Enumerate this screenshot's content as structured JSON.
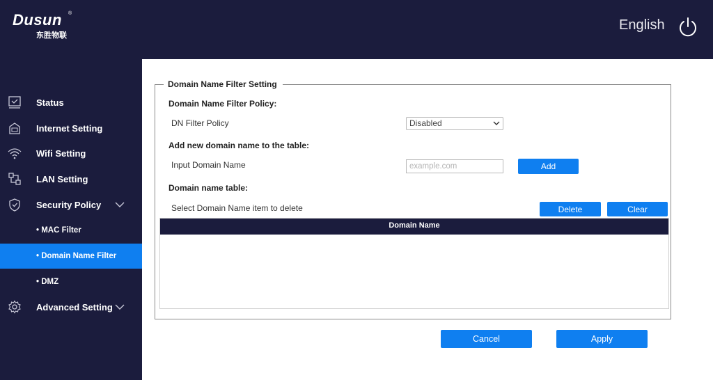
{
  "header": {
    "logo_text": "Dusun",
    "logo_reg": "®",
    "logo_subtext": "东胜物联",
    "language": "English",
    "power_icon": "power-icon"
  },
  "sidebar": {
    "items": [
      {
        "label": "Status",
        "icon": "status-icon"
      },
      {
        "label": "Internet Setting",
        "icon": "internet-icon"
      },
      {
        "label": "Wifi Setting",
        "icon": "wifi-icon"
      },
      {
        "label": "LAN Setting",
        "icon": "lan-icon"
      },
      {
        "label": "Security Policy",
        "icon": "shield-icon",
        "expanded": true
      },
      {
        "label": "Advanced Setting",
        "icon": "gear-icon"
      }
    ],
    "sub_items": [
      {
        "label": "• MAC Filter"
      },
      {
        "label": "• Domain Name Filter",
        "active": true
      },
      {
        "label": "• DMZ"
      }
    ]
  },
  "main": {
    "legend": "Domain Name Filter Setting",
    "policy_heading": "Domain Name Filter Policy:",
    "policy_label": "DN Filter Policy",
    "policy_value": "Disabled",
    "add_heading": "Add new domain name to the table:",
    "input_label": "Input Domain Name",
    "input_placeholder": "example.com",
    "add_button": "Add",
    "table_heading": "Domain name table:",
    "delete_hint": "Select Domain Name item to delete",
    "delete_button": "Delete",
    "clear_button": "Clear",
    "table_column": "Domain Name"
  },
  "footer": {
    "cancel_button": "Cancel",
    "apply_button": "Apply"
  },
  "colors": {
    "nav_bg": "#1b1c3d",
    "accent": "#0f7ff0"
  }
}
